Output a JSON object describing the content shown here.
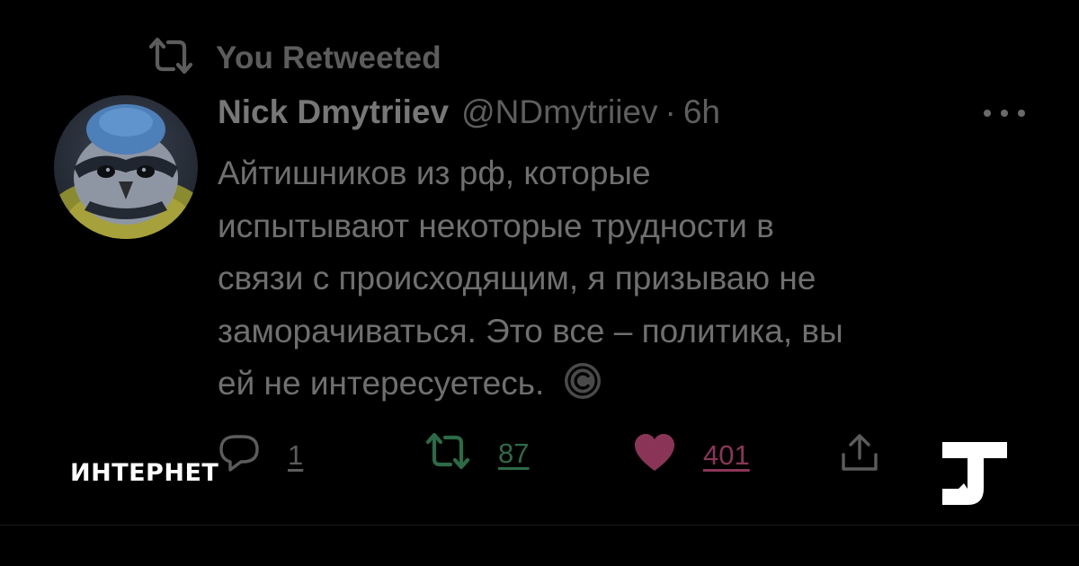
{
  "retweet_header": {
    "icon": "retweet-icon",
    "label": "You Retweeted"
  },
  "tweet": {
    "author_name": "Nick Dmytriiev",
    "author_handle": "@NDmytriiev",
    "separator": "·",
    "time": "6h",
    "more_icon": "more-horizontal-icon",
    "text_lines": [
      "Айтишников из рф, которые",
      "испытывают некоторые трудности в",
      "связи с происходящим, я призываю не",
      "заморачиваться. Это все – политика, вы",
      "ей не интересуетесь."
    ],
    "trailing_emoji": "copyright-icon",
    "actions": {
      "reply_count": "1",
      "retweet_count": "87",
      "like_count": "401"
    }
  },
  "overlay": {
    "section_label": "ИНТЕРНЕТ",
    "logo": "t-logo"
  },
  "colors": {
    "background": "#000000",
    "text": "#6f6f6f",
    "retweet": "#2d6a46",
    "like": "#8a3558",
    "label": "#ffffff"
  }
}
